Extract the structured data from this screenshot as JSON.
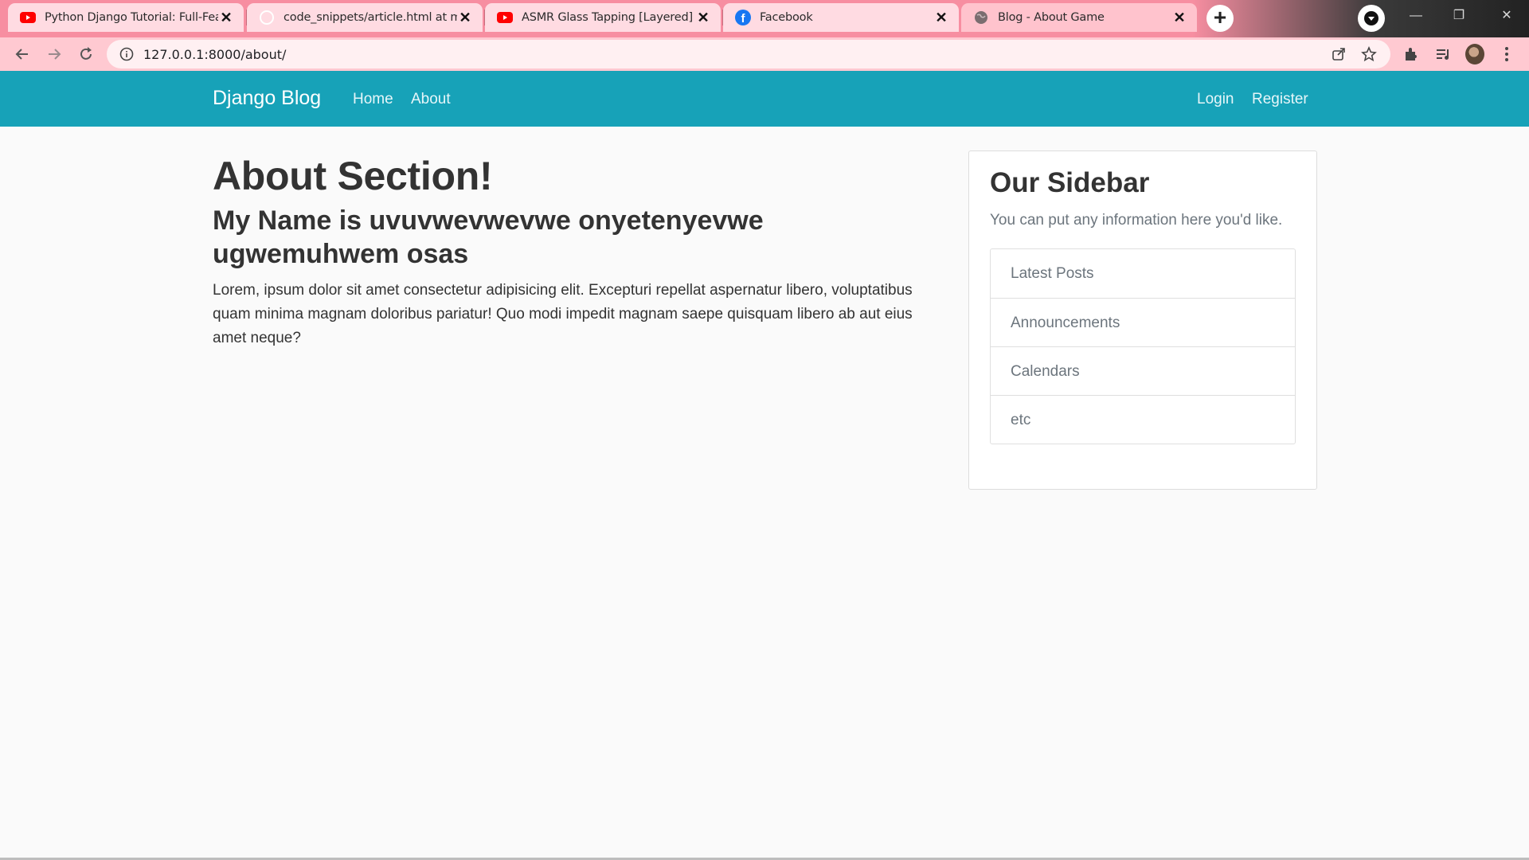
{
  "browser": {
    "tabs": [
      {
        "title": "Python Django Tutorial: Full-Feat",
        "icon": "youtube-icon",
        "active": false
      },
      {
        "title": "code_snippets/article.html at ma",
        "icon": "github-icon",
        "active": false
      },
      {
        "title": "ASMR Glass Tapping [Layered] - Y",
        "icon": "youtube-icon",
        "active": false
      },
      {
        "title": "Facebook",
        "icon": "facebook-icon",
        "active": false
      },
      {
        "title": "Blog - About Game",
        "icon": "globe-icon",
        "active": true
      }
    ],
    "url": "127.0.0.1:8000/about/",
    "colors": {
      "tabstrip": "#f78ea1",
      "toolbar": "#ffc9d1"
    }
  },
  "navbar": {
    "brand": "Django Blog",
    "links": [
      "Home",
      "About"
    ],
    "auth_links": [
      "Login",
      "Register"
    ],
    "color": "#17a2b8"
  },
  "main": {
    "title": "About Section!",
    "subtitle": "My Name is uvuvwevwevwe onyetenyevwe ugwemuhwem osas",
    "body": "Lorem, ipsum dolor sit amet consectetur adipisicing elit. Excepturi repellat aspernatur libero, voluptatibus quam minima magnam doloribus pariatur! Quo modi impedit magnam saepe quisquam libero ab aut eius amet neque?"
  },
  "sidebar": {
    "title": "Our Sidebar",
    "text": "You can put any information here you'd like.",
    "items": [
      "Latest Posts",
      "Announcements",
      "Calendars",
      "etc"
    ]
  }
}
